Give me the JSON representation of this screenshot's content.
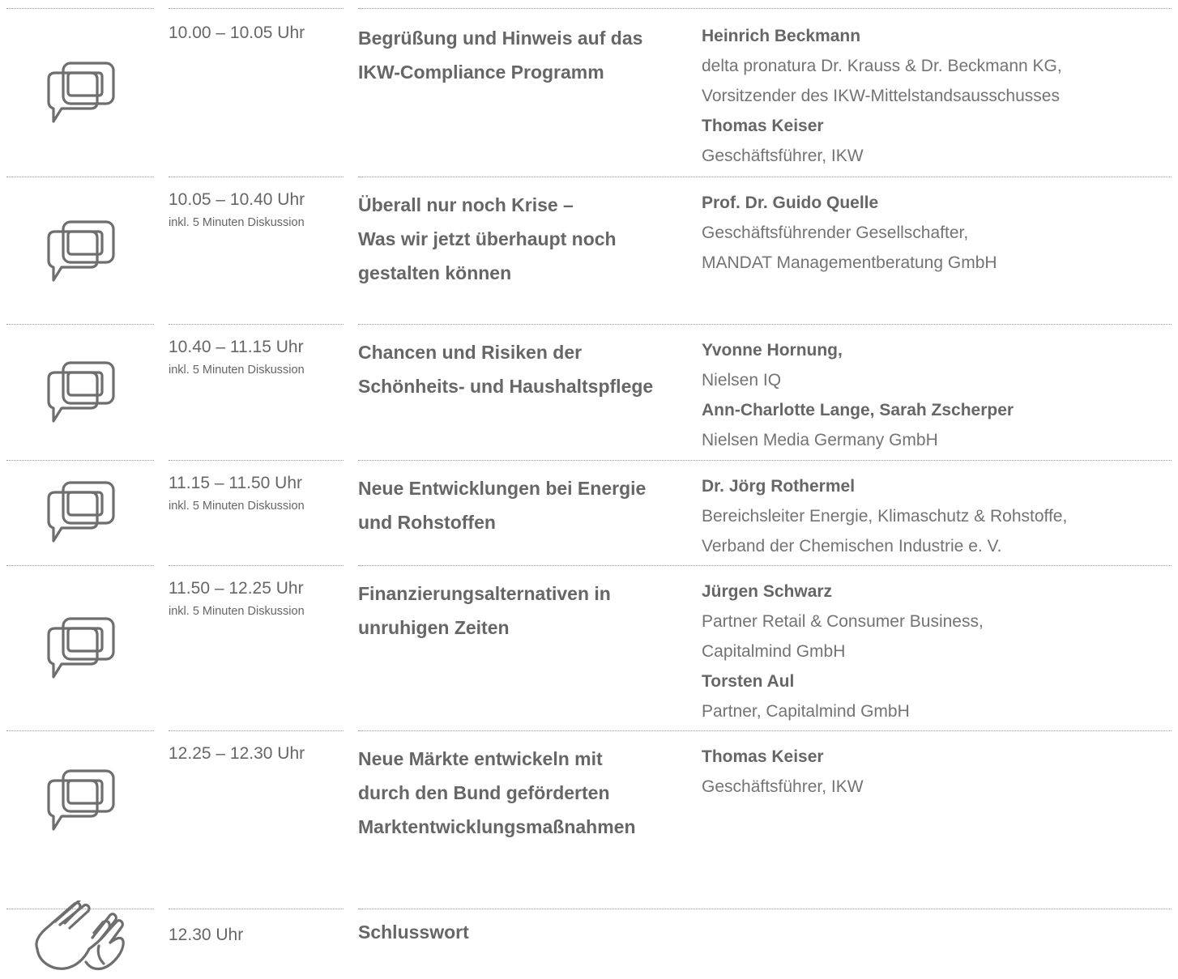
{
  "agenda": [
    {
      "time": "10.00 – 10.05 Uhr",
      "note": "",
      "icon": "speech-bubbles-icon",
      "topic": [
        "Begrüßung und Hinweis auf das",
        "IKW-Compliance Programm"
      ],
      "speakers": [
        {
          "name": "Heinrich Beckmann",
          "lines": [
            "delta pronatura Dr. Krauss & Dr. Beckmann KG,",
            "Vorsitzender des IKW-Mittelstandsausschusses"
          ]
        },
        {
          "name": "Thomas Keiser",
          "lines": [
            "Geschäftsführer, IKW"
          ]
        }
      ]
    },
    {
      "time": "10.05 – 10.40 Uhr",
      "note": "inkl. 5 Minuten Diskussion",
      "icon": "speech-bubbles-icon",
      "topic": [
        "Überall nur noch Krise –",
        "Was wir jetzt überhaupt noch",
        "gestalten können"
      ],
      "speakers": [
        {
          "name": "Prof. Dr. Guido Quelle",
          "lines": [
            "Geschäftsführender Gesellschafter,",
            "MANDAT Managementberatung GmbH"
          ]
        }
      ]
    },
    {
      "time": "10.40 – 11.15 Uhr",
      "note": "inkl. 5 Minuten Diskussion",
      "icon": "speech-bubbles-icon",
      "topic": [
        "Chancen und Risiken der",
        "Schönheits- und Haushaltspflege"
      ],
      "speakers": [
        {
          "name": "Yvonne Hornung,",
          "lines": [
            "Nielsen IQ"
          ]
        },
        {
          "name": "Ann-Charlotte Lange, Sarah Zscherper",
          "lines": [
            "Nielsen Media Germany GmbH"
          ]
        }
      ]
    },
    {
      "time": "11.15 – 11.50 Uhr",
      "note": "inkl. 5 Minuten Diskussion",
      "icon": "speech-bubbles-icon",
      "topic": [
        "Neue Entwicklungen bei Energie",
        "und Rohstoffen"
      ],
      "speakers": [
        {
          "name": "Dr. Jörg Rothermel",
          "lines": [
            "Bereichsleiter Energie, Klimaschutz & Rohstoffe,",
            "Verband der Chemischen Industrie e. V."
          ]
        }
      ]
    },
    {
      "time": "11.50 – 12.25 Uhr",
      "note": "inkl. 5 Minuten Diskussion",
      "icon": "speech-bubbles-icon",
      "topic": [
        "Finanzierungsalternativen in",
        "unruhigen Zeiten"
      ],
      "speakers": [
        {
          "name": "Jürgen Schwarz",
          "lines": [
            "Partner Retail & Consumer Business,",
            "Capitalmind GmbH"
          ]
        },
        {
          "name": "Torsten Aul",
          "lines": [
            "Partner, Capitalmind GmbH"
          ]
        }
      ]
    },
    {
      "time": "12.25 – 12.30 Uhr",
      "note": "",
      "icon": "speech-bubbles-icon",
      "topic": [
        "Neue Märkte entwickeln mit",
        "durch den Bund geförderten",
        "Marktentwicklungsmaßnahmen"
      ],
      "speakers": [
        {
          "name": "Thomas Keiser",
          "lines": [
            "Geschäftsführer, IKW"
          ]
        }
      ]
    },
    {
      "time": "12.30 Uhr",
      "note": "",
      "icon": "clapping-hands-icon",
      "topic": [
        "Schlusswort"
      ],
      "speakers": []
    }
  ]
}
